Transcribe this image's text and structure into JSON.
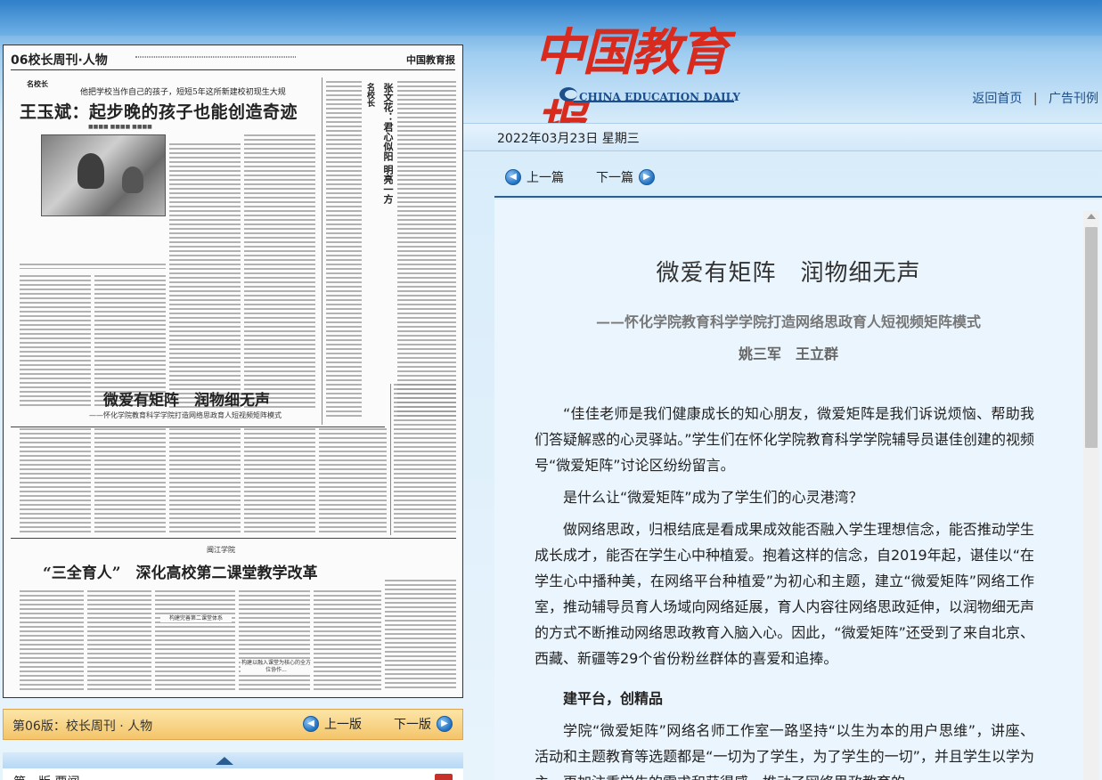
{
  "header": {
    "brand_cn": "中国教育报",
    "brand_en": "CHINA EDUCATION DAILY",
    "links": [
      "返回首页",
      "广告刊例"
    ],
    "link_separator": "|"
  },
  "date_bar": {
    "text": "2022年03月23日  星期三"
  },
  "article_nav": {
    "prev": "上一篇",
    "next": "下一篇"
  },
  "newspaper": {
    "page_label": "06校长周刊·人物",
    "header_logo": "中国教育报",
    "column_tag": "名校长",
    "kicker": "他把学校当作自己的孩子，短短5年这所新建校初现生大规",
    "headline": "王玉斌：起步晚的孩子也能创造奇迹",
    "vertical_title": "张文花：君心似阳 明亮一方",
    "vertical_tag": "名校长",
    "section2_title": "微爱有矩阵　润物细无声",
    "section2_sub": "——怀化学院教育科学学院打造网络思政育人短视频矩阵模式",
    "section3_school": "闽江学院",
    "section3_title": "“三全育人”　深化高校第二课堂教学改革",
    "subheads": [
      "构建完善第二课堂体系",
      "构建以融入课堂为核心的全方位协作..."
    ]
  },
  "page_nav": {
    "label": "第06版：校长周刊 · 人物",
    "prev": "上一版",
    "next": "下一版"
  },
  "bottom_strip": {
    "text": "第一版  要闻"
  },
  "article": {
    "title": "微爱有矩阵　润物细无声",
    "subtitle": "——怀化学院教育科学学院打造网络思政育人短视频矩阵模式",
    "authors": "姚三军　王立群",
    "paragraphs": [
      "“佳佳老师是我们健康成长的知心朋友，微爱矩阵是我们诉说烦恼、帮助我们答疑解惑的心灵驿站。”学生们在怀化学院教育科学学院辅导员谌佳创建的视频号“微爱矩阵”讨论区纷纷留言。",
      "是什么让“微爱矩阵”成为了学生们的心灵港湾？",
      "做网络思政，归根结底是看成果成效能否融入学生理想信念，能否推动学生成长成才，能否在学生心中种植爱。抱着这样的信念，自2019年起，谌佳以“在学生心中播种美，在网络平台种植爱”为初心和主题，建立“微爱矩阵”网络工作室，推动辅导员育人场域向网络延展，育人内容往网络思政延伸，以润物细无声的方式不断推动网络思政教育入脑入心。因此，“微爱矩阵”还受到了来自北京、西藏、新疆等29个省份粉丝群体的喜爱和追捧。",
      "建平台，创精品",
      "学院“微爱矩阵”网络名师工作室一路坚持“以生为本的用户思维”，讲座、活动和主题教育等选题都是“一切为了学生，为了学生的一切”，并且学生以学为主，更加注重学生的需求和获得感，推动了网络思政教育的"
    ]
  },
  "colors": {
    "brand_red": "#d82a1d",
    "brand_blue": "#1d4f8c",
    "nav_orange": "#f4c56a"
  }
}
